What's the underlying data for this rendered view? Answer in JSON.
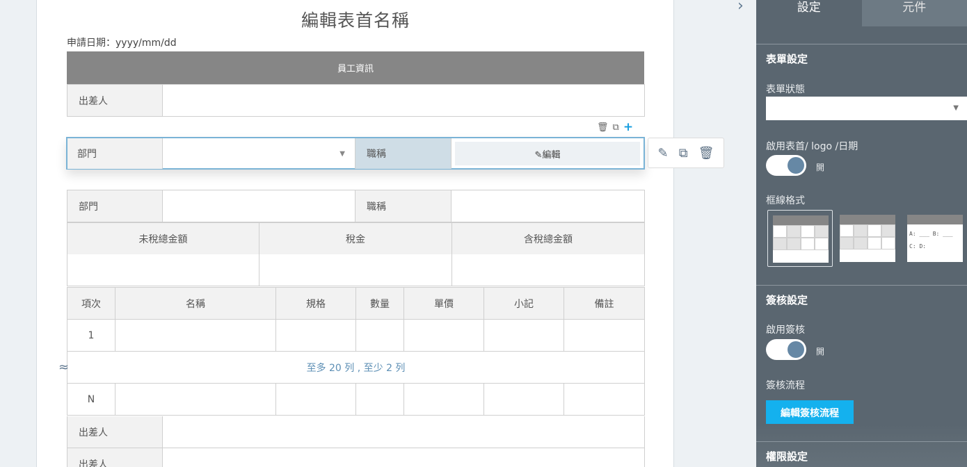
{
  "form": {
    "title": "編輯表首名稱",
    "apply_date": "申請日期：yyyy/mm/dd",
    "section_header": "員工資訊",
    "traveler_label": "出差人",
    "department_label": "部門",
    "job_title_label": "職稱",
    "edit_label": "✎編輯",
    "amounts": {
      "pre_tax": "未稅總金額",
      "tax": "稅金",
      "with_tax": "含稅總金額"
    },
    "items_table": {
      "headers": [
        "項次",
        "名稱",
        "規格",
        "數量",
        "單價",
        "小記",
        "備註"
      ],
      "first_row": "1",
      "last_row": "N",
      "limit_note": "至多 20 列 , 至少 2 列"
    },
    "bottom_rows": [
      "出差人",
      "出差人"
    ]
  },
  "panel": {
    "tabs": [
      "設定",
      "元件"
    ],
    "form_settings": {
      "heading": "表單設定",
      "status_label": "表單狀態",
      "status_value": "",
      "header_toggle_label": "啟用表首/ logo /日期",
      "header_toggle_state": "開",
      "border_label": "框線格式",
      "border_option_text": "A: ___ B: ___ C: D:"
    },
    "approval_settings": {
      "heading": "簽核設定",
      "enable_label": "啟用簽核",
      "enable_state": "開",
      "flow_label": "簽核流程",
      "flow_button": "編輯簽核流程"
    },
    "permission_settings": {
      "heading": "權限設定"
    }
  },
  "icons": {
    "collapse": "chevron-right-icon",
    "trash": "trash-icon",
    "copy": "copy-icon",
    "add": "plus-icon",
    "pencil": "pencil-icon",
    "resize": "wave-icon"
  }
}
